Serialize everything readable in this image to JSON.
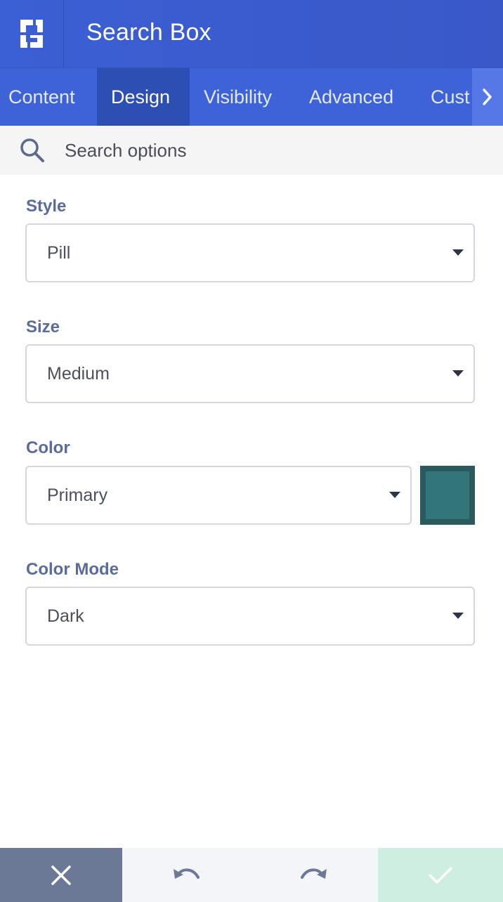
{
  "header": {
    "title": "Search Box",
    "logo_icon": "builder-logo-icon"
  },
  "tabs": [
    {
      "label": "Content",
      "active": false
    },
    {
      "label": "Design",
      "active": true
    },
    {
      "label": "Visibility",
      "active": false
    },
    {
      "label": "Advanced",
      "active": false
    },
    {
      "label": "Cust",
      "active": false
    }
  ],
  "tabs_scroll_icon": "chevron-right-icon",
  "search": {
    "placeholder": "Search options",
    "icon": "search-icon"
  },
  "fields": {
    "style": {
      "label": "Style",
      "value": "Pill"
    },
    "size": {
      "label": "Size",
      "value": "Medium"
    },
    "color": {
      "label": "Color",
      "value": "Primary",
      "swatch": "#327679"
    },
    "color_mode": {
      "label": "Color Mode",
      "value": "Dark"
    }
  },
  "footer": {
    "close_icon": "close-icon",
    "undo_icon": "undo-icon",
    "redo_icon": "redo-icon",
    "save_icon": "check-icon"
  },
  "colors": {
    "header": "#3b5fd4",
    "tab_active": "#2d4fb4",
    "label": "#5a6b9c",
    "close_button": "#6b7896",
    "save_button": "#cdeee0"
  }
}
